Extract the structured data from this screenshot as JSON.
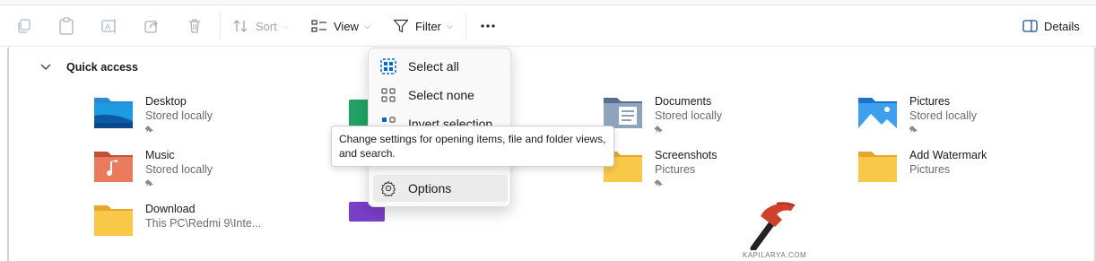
{
  "toolbar": {
    "sort_label": "Sort",
    "view_label": "View",
    "filter_label": "Filter",
    "details_label": "Details"
  },
  "section": {
    "title": "Quick access"
  },
  "tiles": [
    {
      "name": "Desktop",
      "sub": "Stored locally",
      "icon": "desktop-folder-icon",
      "pinned": true
    },
    {
      "name": "Documents",
      "sub": "Stored locally",
      "icon": "documents-folder-icon",
      "pinned": true
    },
    {
      "name": "Pictures",
      "sub": "Stored locally",
      "icon": "pictures-folder-icon",
      "pinned": true
    },
    {
      "name": "Music",
      "sub": "Stored locally",
      "icon": "music-folder-icon",
      "pinned": true
    },
    {
      "name": "Screenshots",
      "sub": "Pictures",
      "icon": "folder-icon",
      "pinned": true
    },
    {
      "name": "Add Watermark",
      "sub": "Pictures",
      "icon": "folder-icon",
      "pinned": false
    },
    {
      "name": "Download",
      "sub": "This PC\\Redmi 9\\Inte...",
      "icon": "folder-icon",
      "pinned": false
    }
  ],
  "menu": {
    "items": [
      {
        "label": "Select all",
        "icon": "select-all-icon"
      },
      {
        "label": "Select none",
        "icon": "select-none-icon"
      },
      {
        "label": "Invert selection",
        "icon": "invert-selection-icon"
      },
      {
        "label": "Options",
        "icon": "gear-icon"
      }
    ]
  },
  "tooltip": {
    "text": "Change settings for opening items, file and folder views, and search."
  },
  "watermark": {
    "text": "KAPILARYA.COM"
  },
  "colors": {
    "folder_yellow": "#f8c849",
    "accent_blue": "#0067c0"
  }
}
